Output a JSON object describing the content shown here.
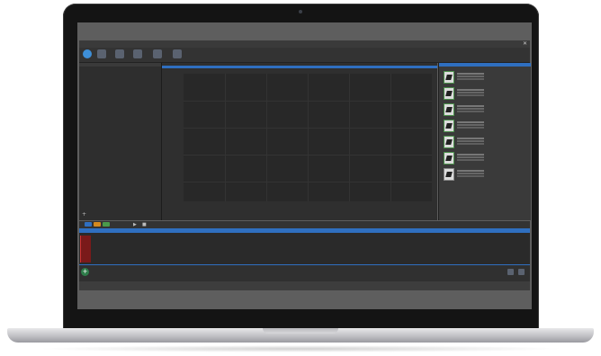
{
  "window": {
    "title_text": "",
    "close_glyph": "✕"
  },
  "ribbon": {
    "buttons": [
      {
        "icon": "home-icon",
        "label": ""
      },
      {
        "icon": "device-icon",
        "label": ""
      },
      {
        "icon": "person-icon",
        "label": ""
      },
      {
        "icon": "settings-icon",
        "label": ""
      },
      {
        "icon": "export-icon",
        "label": ""
      },
      {
        "icon": "help-icon",
        "label": ""
      }
    ]
  },
  "left_panel": {
    "rows": [
      "",
      ""
    ],
    "add_glyph": "+"
  },
  "center_panel": {
    "tab_label": "",
    "y_axis_label": "",
    "x_axis_label": ""
  },
  "right_panel": {
    "title": "",
    "item_count": 7
  },
  "timeline": {
    "ticks": [
      "",
      "",
      "",
      "",
      "",
      "",
      ""
    ],
    "add_glyph": "+",
    "play_glyph": "▶",
    "stop_glyph": "■"
  },
  "colors": {
    "accent": "#2f6fc0",
    "app_background": "#2b2b2b",
    "clip": "#7a1a1a",
    "add_button": "#2e7d4a"
  }
}
